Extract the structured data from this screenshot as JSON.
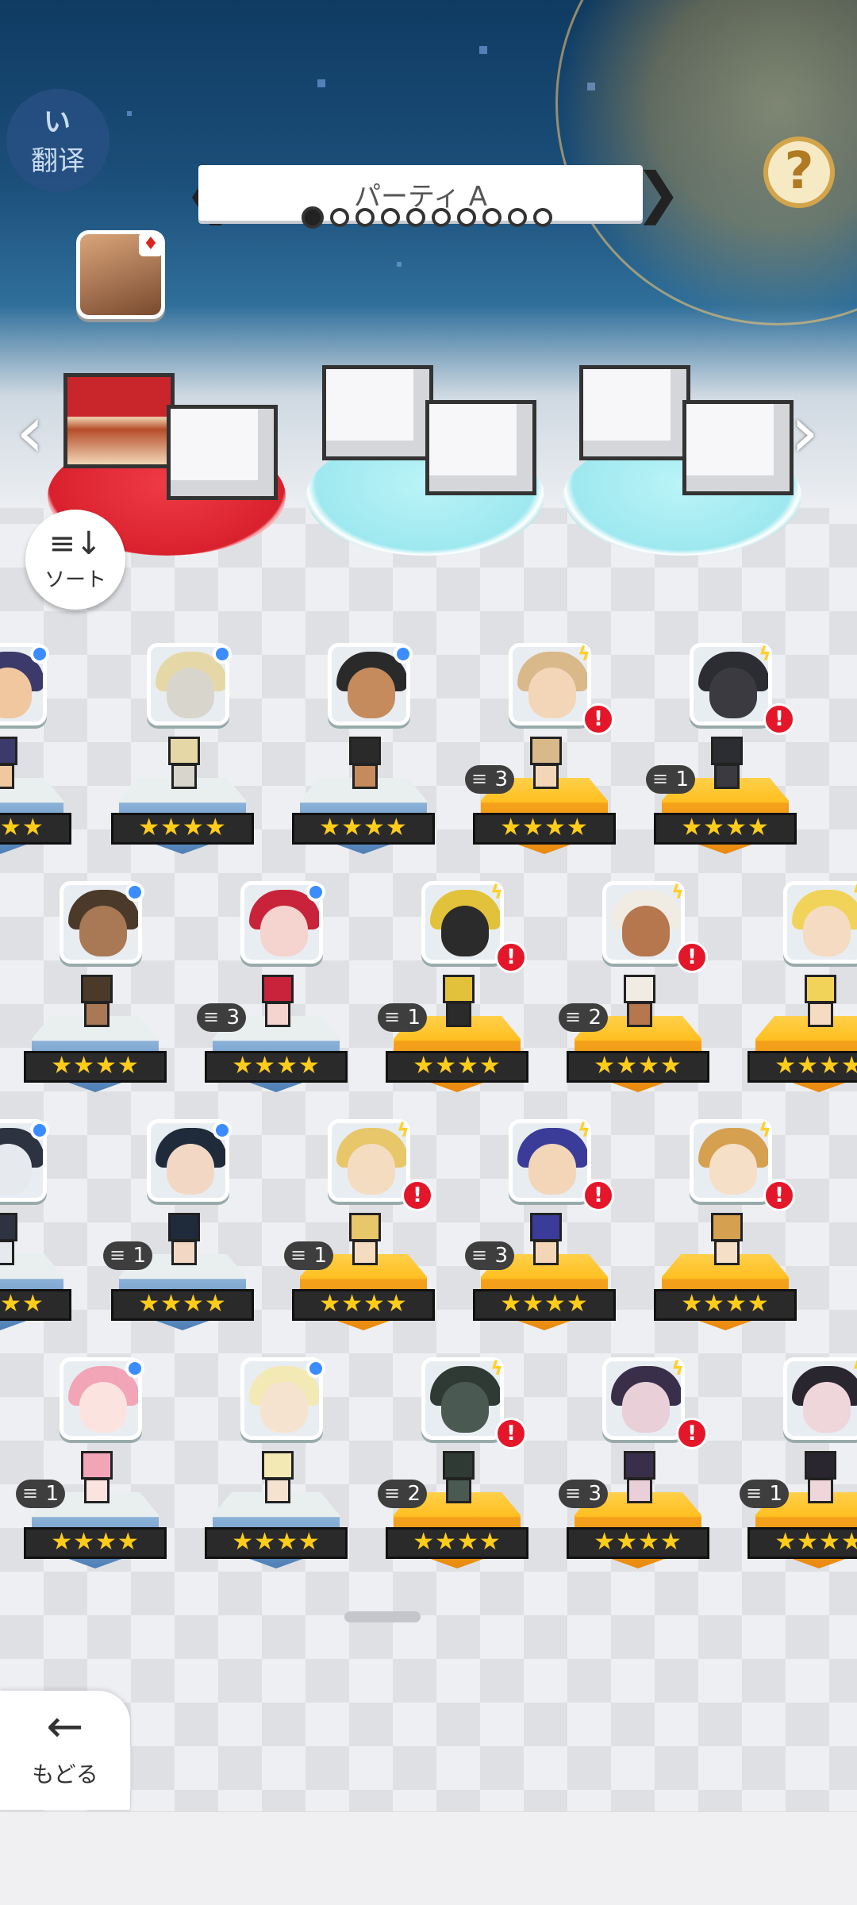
{
  "translate": {
    "logo": "い",
    "label": "翻译"
  },
  "help": {
    "label": "?"
  },
  "party": {
    "name": "パーティ A",
    "prev": "❮",
    "next": "❯",
    "page": 1,
    "pages": 10
  },
  "slots_nav": {
    "left": "‹",
    "right": "›"
  },
  "sort": {
    "icon": "≡↓",
    "label": "ソート"
  },
  "back": {
    "icon": "←",
    "label": "もどる"
  },
  "characters": [
    {
      "stars": "★★★★",
      "count": "",
      "type": "circle",
      "alert": false,
      "ped": "blue",
      "hair": "#3b3a6a",
      "skin": "#f1c7a0"
    },
    {
      "stars": "★★★★",
      "count": "",
      "type": "circle",
      "alert": false,
      "ped": "blue",
      "hair": "#e6d8a6",
      "skin": "#d8d6cc"
    },
    {
      "stars": "★★★★",
      "count": "",
      "type": "circle",
      "alert": false,
      "ped": "blue",
      "hair": "#2a2a2a",
      "skin": "#c58b5d"
    },
    {
      "stars": "★★★★",
      "count": "3",
      "type": "bolt",
      "alert": true,
      "ped": "gold",
      "hair": "#d9b88a",
      "skin": "#f3d6b7"
    },
    {
      "stars": "★★★★",
      "count": "1",
      "type": "bolt",
      "alert": true,
      "ped": "gold",
      "hair": "#2c2c33",
      "skin": "#3a3a40"
    },
    {
      "stars": "★★★★",
      "count": "",
      "type": "circle",
      "alert": false,
      "ped": "blue",
      "hair": "#4b3a2a",
      "skin": "#a87954"
    },
    {
      "stars": "★★★★",
      "count": "3",
      "type": "circle",
      "alert": false,
      "ped": "blue",
      "hair": "#c8233a",
      "skin": "#f5d3cf"
    },
    {
      "stars": "★★★★",
      "count": "1",
      "type": "bolt",
      "alert": true,
      "ped": "gold",
      "hair": "#e2c23a",
      "skin": "#2b2b2b"
    },
    {
      "stars": "★★★★",
      "count": "2",
      "type": "bolt",
      "alert": true,
      "ped": "gold",
      "hair": "#f0ece4",
      "skin": "#b6764e"
    },
    {
      "stars": "★★★★",
      "count": "",
      "type": "bolt",
      "alert": true,
      "ped": "gold",
      "hair": "#f1d35a",
      "skin": "#f4dbc1"
    },
    {
      "stars": "★★★★",
      "count": "",
      "type": "circle",
      "alert": false,
      "ped": "blue",
      "hair": "#2d3340",
      "skin": "#e6e9ee"
    },
    {
      "stars": "★★★★",
      "count": "1",
      "type": "circle",
      "alert": false,
      "ped": "blue",
      "hair": "#1f2a3a",
      "skin": "#f2d8c4"
    },
    {
      "stars": "★★★★",
      "count": "1",
      "type": "bolt",
      "alert": true,
      "ped": "gold",
      "hair": "#e8c66a",
      "skin": "#f4dcc0"
    },
    {
      "stars": "★★★★",
      "count": "3",
      "type": "bolt",
      "alert": true,
      "ped": "gold",
      "hair": "#3b3b9a",
      "skin": "#f3d6b7"
    },
    {
      "stars": "★★★★",
      "count": "",
      "type": "bolt",
      "alert": true,
      "ped": "gold",
      "hair": "#d5a050",
      "skin": "#f6dfc7"
    },
    {
      "stars": "★★★★",
      "count": "1",
      "type": "circle",
      "alert": false,
      "ped": "blue",
      "hair": "#f1a5b7",
      "skin": "#fbe3e0"
    },
    {
      "stars": "★★★★",
      "count": "",
      "type": "circle",
      "alert": false,
      "ped": "blue",
      "hair": "#f3e9b5",
      "skin": "#f6e3cf"
    },
    {
      "stars": "★★★★",
      "count": "2",
      "type": "bolt",
      "alert": true,
      "ped": "gold",
      "hair": "#2e3a33",
      "skin": "#4a5a52"
    },
    {
      "stars": "★★★★",
      "count": "3",
      "type": "bolt",
      "alert": true,
      "ped": "gold",
      "hair": "#3a2f4a",
      "skin": "#e9cfd7"
    },
    {
      "stars": "★★★★",
      "count": "1",
      "type": "bolt",
      "alert": true,
      "ped": "gold",
      "hair": "#2a2630",
      "skin": "#efd6da"
    }
  ],
  "colors": {
    "sky_top": "#0f3b62",
    "accent_gold": "#ffbf20",
    "alert_red": "#e4172a",
    "type_blue": "#3b8cff"
  }
}
